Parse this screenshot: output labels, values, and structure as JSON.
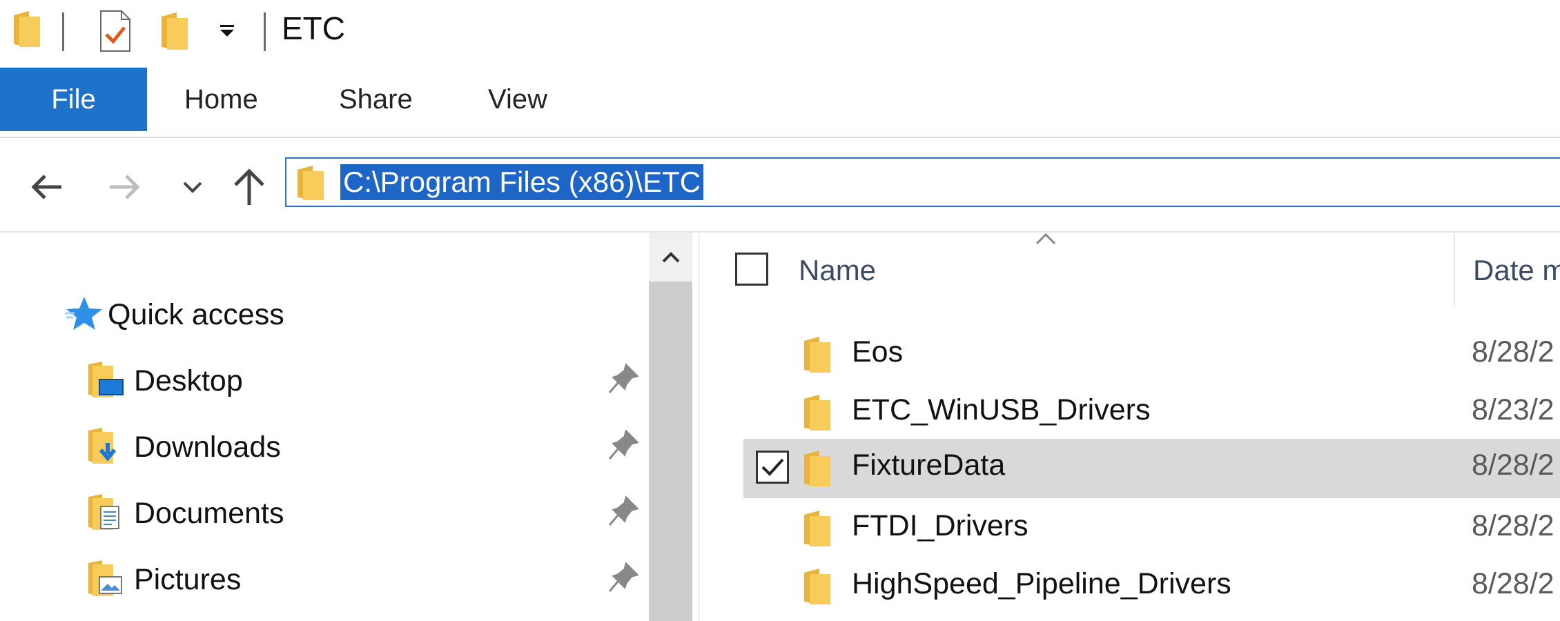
{
  "window": {
    "title": "ETC"
  },
  "ribbon": {
    "tabs": [
      {
        "label": "File"
      },
      {
        "label": "Home"
      },
      {
        "label": "Share"
      },
      {
        "label": "View"
      }
    ]
  },
  "address_bar": {
    "path": "C:\\Program Files (x86)\\ETC"
  },
  "nav_pane": {
    "quick_access_label": "Quick access",
    "items": [
      {
        "label": "Desktop",
        "icon": "desktop-folder-icon"
      },
      {
        "label": "Downloads",
        "icon": "downloads-folder-icon"
      },
      {
        "label": "Documents",
        "icon": "documents-folder-icon"
      },
      {
        "label": "Pictures",
        "icon": "pictures-folder-icon"
      }
    ]
  },
  "file_list": {
    "columns": {
      "name": "Name",
      "date": "Date m"
    },
    "rows": [
      {
        "name": "Eos",
        "date": "8/28/2",
        "selected": false
      },
      {
        "name": "ETC_WinUSB_Drivers",
        "date": "8/23/2",
        "selected": false
      },
      {
        "name": "FixtureData",
        "date": "8/28/2",
        "selected": true
      },
      {
        "name": "FTDI_Drivers",
        "date": "8/28/2",
        "selected": false
      },
      {
        "name": "HighSpeed_Pipeline_Drivers",
        "date": "8/28/2",
        "selected": false
      }
    ]
  },
  "colors": {
    "accent": "#1f72c9",
    "selection_highlight": "#1e65c8",
    "folder": "#f4c64f"
  }
}
